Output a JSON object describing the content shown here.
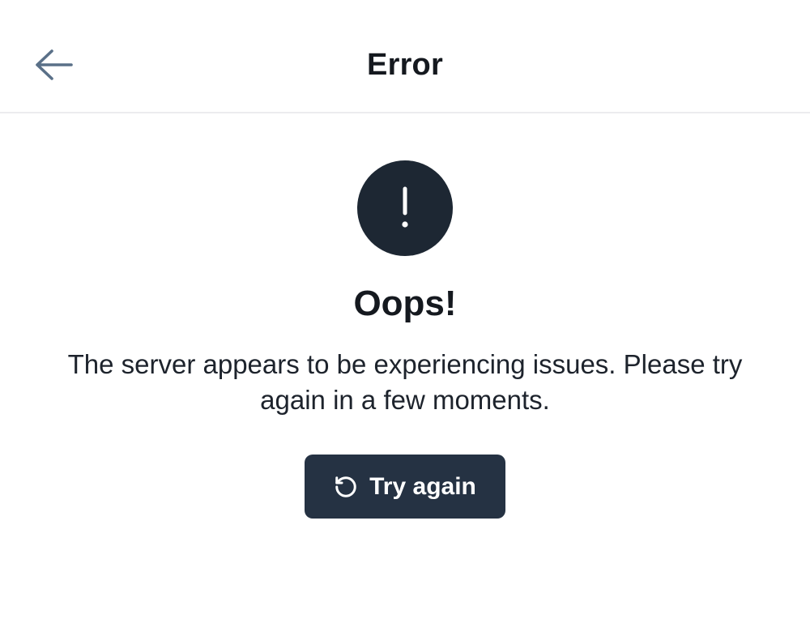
{
  "header": {
    "title": "Error",
    "back_icon": "arrow-left-icon"
  },
  "error": {
    "icon": "exclamation-circle-icon",
    "heading": "Oops!",
    "message": "The server appears to be experiencing issues. Please try again in a few moments."
  },
  "retry_button": {
    "label": "Try again",
    "icon": "rotate-ccw-icon"
  },
  "colors": {
    "background": "#ffffff",
    "primary": "#253243",
    "icon_circle": "#1d2733",
    "back_arrow": "#5a7088",
    "text": "#15191f",
    "divider": "#ececef"
  }
}
